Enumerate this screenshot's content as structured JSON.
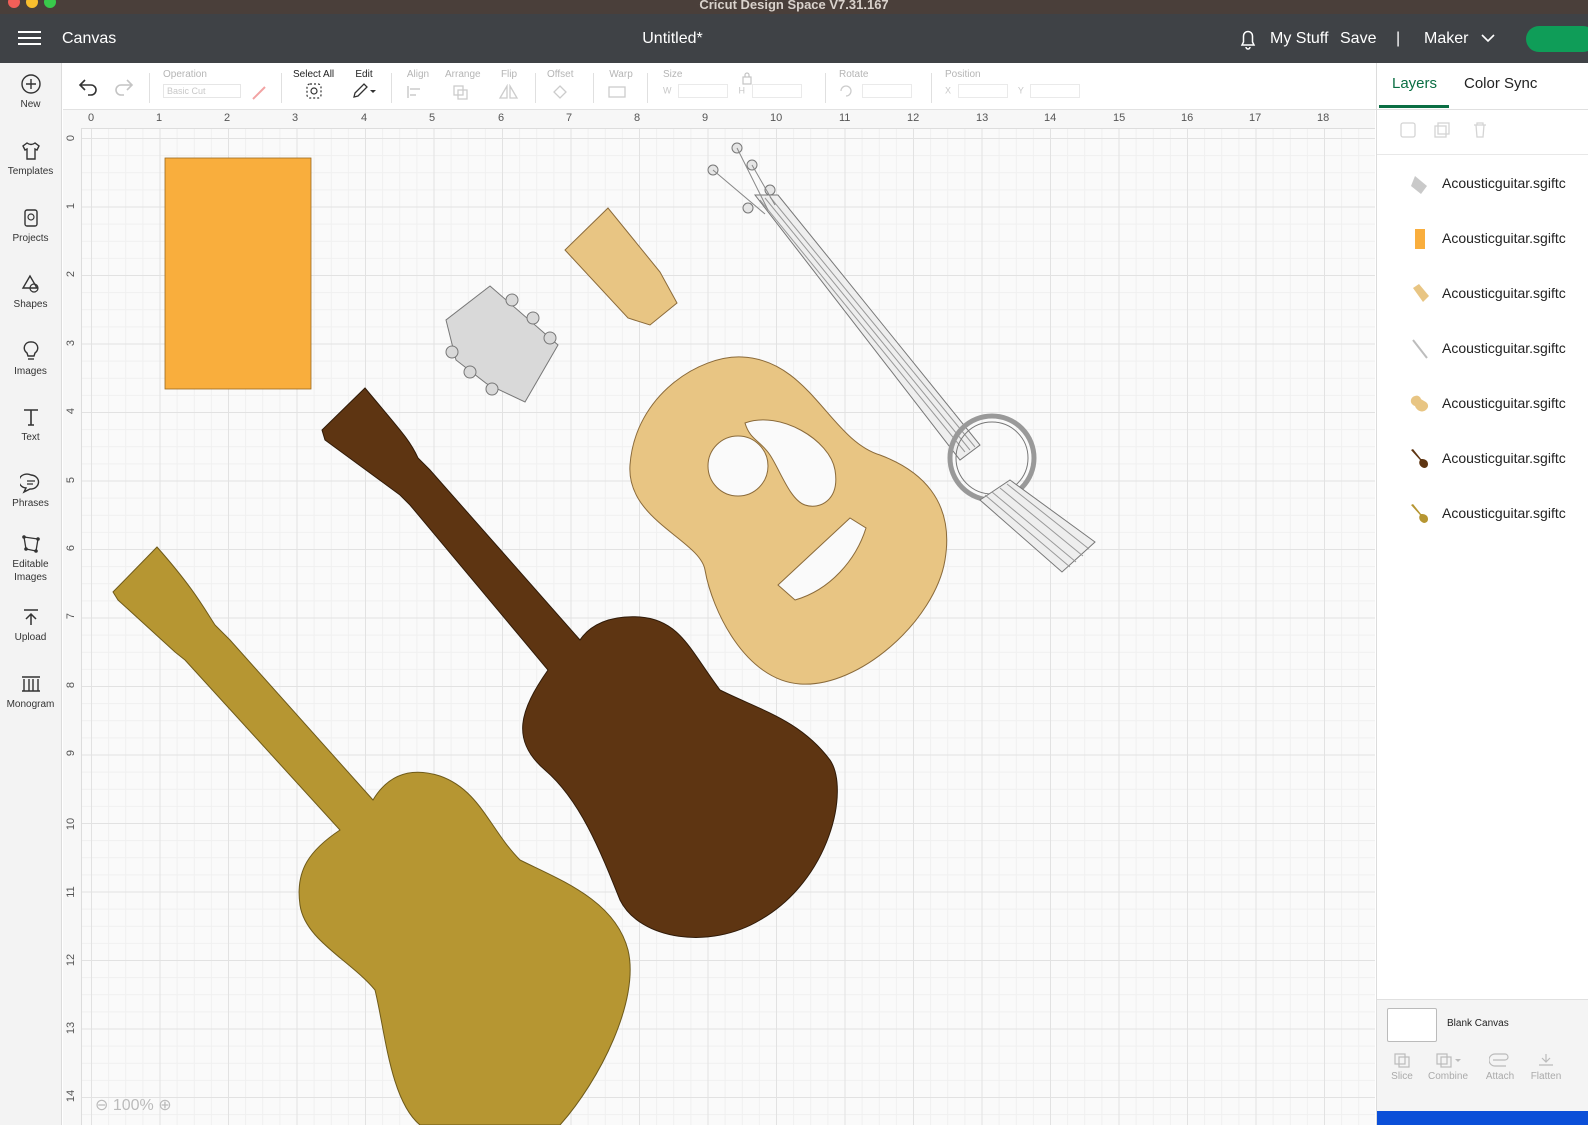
{
  "window": {
    "title": "Cricut Design Space  V7.31.167"
  },
  "header": {
    "section": "Canvas",
    "doc_title": "Untitled*",
    "my_stuff": "My Stuff",
    "save": "Save",
    "divider": "|",
    "machine": "Maker",
    "accent": "#0f9d58"
  },
  "toolbar": {
    "operation_label": "Operation",
    "operation_value": "Basic Cut",
    "select_all": "Select All",
    "edit": "Edit",
    "align": "Align",
    "arrange": "Arrange",
    "flip": "Flip",
    "offset": "Offset",
    "warp": "Warp",
    "size": "Size",
    "size_w": "W",
    "size_h": "H",
    "rotate": "Rotate",
    "position": "Position",
    "pos_x": "X",
    "pos_y": "Y"
  },
  "sidebar": {
    "items": [
      {
        "label": "New",
        "icon": "plus-circle-icon"
      },
      {
        "label": "Templates",
        "icon": "shirt-icon"
      },
      {
        "label": "Projects",
        "icon": "projects-icon"
      },
      {
        "label": "Shapes",
        "icon": "shapes-icon"
      },
      {
        "label": "Images",
        "icon": "lightbulb-icon"
      },
      {
        "label": "Text",
        "icon": "text-icon"
      },
      {
        "label": "Phrases",
        "icon": "speech-bubble-icon"
      },
      {
        "label": "Editable Images",
        "icon": "editable-images-icon"
      },
      {
        "label": "Upload",
        "icon": "upload-icon"
      },
      {
        "label": "Monogram",
        "icon": "monogram-icon"
      }
    ]
  },
  "ruler": {
    "top": [
      "0",
      "1",
      "2",
      "3",
      "4",
      "5",
      "6",
      "7",
      "8",
      "9",
      "10",
      "11",
      "12",
      "13",
      "14",
      "15",
      "16",
      "17",
      "18"
    ],
    "left": [
      "0",
      "1",
      "2",
      "3",
      "4",
      "5",
      "6",
      "7",
      "8",
      "9",
      "10",
      "11",
      "12",
      "13",
      "14"
    ]
  },
  "right_panel": {
    "tabs": [
      "Layers",
      "Color Sync"
    ],
    "layers": [
      {
        "name": "Acousticguitar.sgiftc",
        "color": "#c9c9c9"
      },
      {
        "name": "Acousticguitar.sgiftc",
        "color": "#f9ae3d"
      },
      {
        "name": "Acousticguitar.sgiftc",
        "color": "#e8c583"
      },
      {
        "name": "Acousticguitar.sgiftc",
        "color": "#bdbdbd"
      },
      {
        "name": "Acousticguitar.sgiftc",
        "color": "#e8c583"
      },
      {
        "name": "Acousticguitar.sgiftc",
        "color": "#5e3512"
      },
      {
        "name": "Acousticguitar.sgiftc",
        "color": "#b69632"
      }
    ],
    "blank_canvas": "Blank Canvas",
    "actions": [
      "Slice",
      "Combine",
      "Attach",
      "Flatten"
    ]
  },
  "zoom": {
    "value": "100%"
  },
  "colors": {
    "orange": "#f9ae3d",
    "tan": "#e8c583",
    "brown": "#5e3512",
    "gold": "#b69632",
    "gray": "#d9d9d9"
  }
}
